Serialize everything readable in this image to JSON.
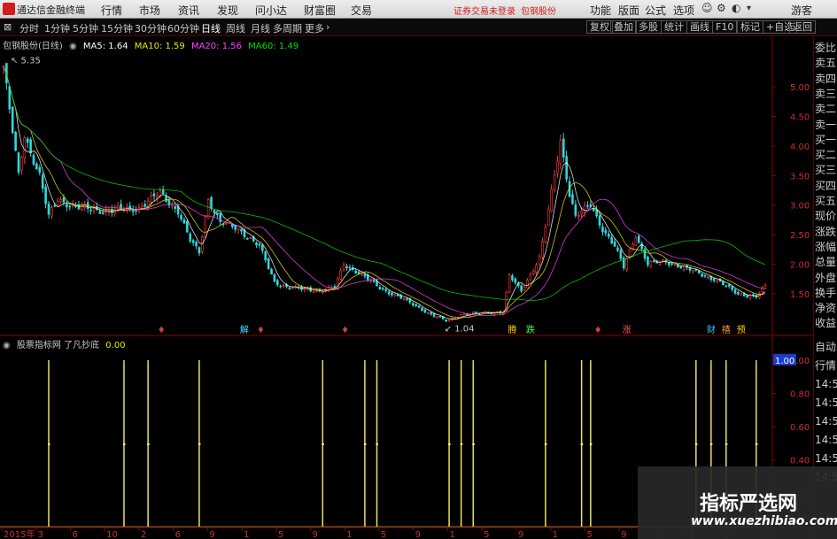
{
  "menu": {
    "app_title": "通达信金融终端",
    "items": [
      "行情",
      "市场",
      "资讯",
      "发现",
      "问小达",
      "财富圈",
      "交易"
    ],
    "notice_login": "证券交易未登录",
    "notice_stock": "包钢股份",
    "right_items": [
      "功能",
      "版面",
      "公式",
      "选项"
    ],
    "guest": "游客"
  },
  "toolbar": {
    "periods": [
      "分时",
      "1分钟",
      "5分钟",
      "15分钟",
      "30分钟",
      "60分钟",
      "日线",
      "周线",
      "月线",
      "多周期",
      "更多"
    ],
    "active_period": "日线",
    "tools": [
      "复权",
      "叠加",
      "多股",
      "统计",
      "画线",
      "F10",
      "标记",
      "+自选",
      "返回"
    ]
  },
  "main_chart": {
    "title": "包钢股份(日线)",
    "ma_labels": [
      {
        "text": "MA5: 1.64",
        "color": "#ffffff"
      },
      {
        "text": "MA10: 1.59",
        "color": "#e8e800"
      },
      {
        "text": "MA20: 1.56",
        "color": "#ff40ff"
      },
      {
        "text": "MA60: 1.49",
        "color": "#00e000"
      }
    ],
    "max_label": "5.35",
    "min_label": "1.04",
    "event_tags": [
      {
        "text": "解",
        "color": "#40e0ff",
        "idx": 80
      },
      {
        "text": "腾",
        "color": "#ffd000",
        "idx": 169
      },
      {
        "text": "跌",
        "color": "#40ff40",
        "idx": 175
      },
      {
        "text": "涨",
        "color": "#ff5050",
        "idx": 207
      },
      {
        "text": "财",
        "color": "#40c0ff",
        "idx": 235
      },
      {
        "text": "禧",
        "color": "#ffa040",
        "idx": 240
      },
      {
        "text": "预",
        "color": "#ffd000",
        "idx": 245
      }
    ],
    "small_marks": [
      {
        "text": "♦",
        "idx": 52
      },
      {
        "text": "♦",
        "idx": 85
      },
      {
        "text": "♦",
        "idx": 113
      },
      {
        "text": "♦",
        "idx": 197
      }
    ]
  },
  "sub_chart": {
    "title": "股票指标网 了凡抄底",
    "value": "0.00",
    "current_value": "1.00"
  },
  "watermark": {
    "cn": "指标严选网",
    "url": "www.xuezhibiao.com"
  },
  "right_panel": [
    "委比",
    "卖五",
    "卖四",
    "卖三",
    "卖二",
    "卖一",
    "买一",
    "买二",
    "买三",
    "买四",
    "买五",
    "现价",
    "涨跌",
    "涨幅",
    "总量",
    "外盘",
    "换手",
    "净资",
    "收益"
  ],
  "right_panel_lower": [
    "自动",
    "行情",
    "14:5",
    "14:5",
    "14:5",
    "14:5",
    "14:5",
    "14:5"
  ],
  "chart_data": [
    {
      "type": "line",
      "title": "包钢股份(日线)",
      "x_ticks": [
        "2015年",
        "3",
        "6",
        "10",
        "2",
        "6",
        "9",
        "1",
        "5",
        "9",
        "1",
        "5",
        "9",
        "1",
        "5",
        "9",
        "1",
        "5",
        "9",
        "1",
        "5",
        "9",
        "1"
      ],
      "ylim": [
        0.9,
        5.6
      ],
      "y_ticks": [
        1.5,
        2.0,
        2.5,
        3.0,
        3.5,
        4.0,
        4.5,
        5.0
      ],
      "y_tick_labels": [
        "1.50",
        "2.00",
        "2.50",
        "3.00",
        "3.50",
        "4.00",
        "4.50",
        "5.00"
      ],
      "anchors": [
        [
          0,
          5.35
        ],
        [
          2,
          4.6
        ],
        [
          5,
          3.5
        ],
        [
          7,
          4.2
        ],
        [
          9,
          3.9
        ],
        [
          12,
          3.5
        ],
        [
          15,
          2.8
        ],
        [
          18,
          3.1
        ],
        [
          25,
          2.95
        ],
        [
          35,
          2.9
        ],
        [
          45,
          2.95
        ],
        [
          52,
          3.2
        ],
        [
          58,
          2.9
        ],
        [
          62,
          2.4
        ],
        [
          65,
          2.2
        ],
        [
          68,
          3.1
        ],
        [
          72,
          2.7
        ],
        [
          78,
          2.6
        ],
        [
          85,
          2.3
        ],
        [
          90,
          1.7
        ],
        [
          95,
          1.6
        ],
        [
          105,
          1.55
        ],
        [
          110,
          1.6
        ],
        [
          113,
          2.0
        ],
        [
          118,
          1.85
        ],
        [
          125,
          1.6
        ],
        [
          135,
          1.35
        ],
        [
          142,
          1.15
        ],
        [
          147,
          1.04
        ],
        [
          152,
          1.15
        ],
        [
          160,
          1.18
        ],
        [
          166,
          1.2
        ],
        [
          168,
          1.8
        ],
        [
          172,
          1.55
        ],
        [
          178,
          2.1
        ],
        [
          181,
          2.9
        ],
        [
          185,
          4.1
        ],
        [
          188,
          3.2
        ],
        [
          190,
          2.8
        ],
        [
          195,
          3.0
        ],
        [
          199,
          2.6
        ],
        [
          203,
          2.3
        ],
        [
          206,
          1.95
        ],
        [
          210,
          2.5
        ],
        [
          214,
          2.0
        ],
        [
          220,
          2.05
        ],
        [
          228,
          1.9
        ],
        [
          236,
          1.75
        ],
        [
          244,
          1.5
        ],
        [
          250,
          1.45
        ],
        [
          253,
          1.62
        ]
      ],
      "n_points": 254
    },
    {
      "type": "bar",
      "title": "股票指标网 了凡抄底",
      "ylim": [
        0.0,
        1.1
      ],
      "y_ticks": [
        0.2,
        0.4,
        0.6,
        0.8,
        1.0
      ],
      "y_tick_labels": [
        "0.20",
        "0.40",
        "0.60",
        "0.80",
        "1.00"
      ],
      "signal_indices": [
        15,
        40,
        48,
        65,
        106,
        120,
        124,
        148,
        152,
        156,
        180,
        192,
        195,
        230,
        235,
        240,
        250
      ],
      "signal_value": 1.0
    }
  ]
}
